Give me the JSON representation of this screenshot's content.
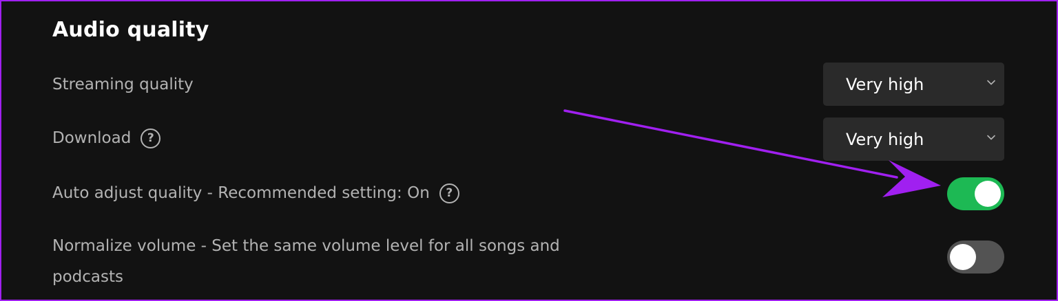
{
  "section": {
    "title": "Audio quality"
  },
  "settings": {
    "streaming_quality": {
      "label": "Streaming quality",
      "value": "Very high"
    },
    "download": {
      "label": "Download",
      "value": "Very high",
      "help_icon": "question-circle-icon"
    },
    "auto_adjust": {
      "label": "Auto adjust quality - Recommended setting: On",
      "help_icon": "question-circle-icon",
      "enabled": true
    },
    "normalize_volume": {
      "label": "Normalize volume - Set the same volume level for all songs and podcasts",
      "enabled": false
    }
  },
  "colors": {
    "background": "#121212",
    "accent_green": "#1db954",
    "toggle_off": "#535353",
    "dropdown_bg": "#2a2a2a",
    "annotation_arrow": "#a020f0"
  }
}
